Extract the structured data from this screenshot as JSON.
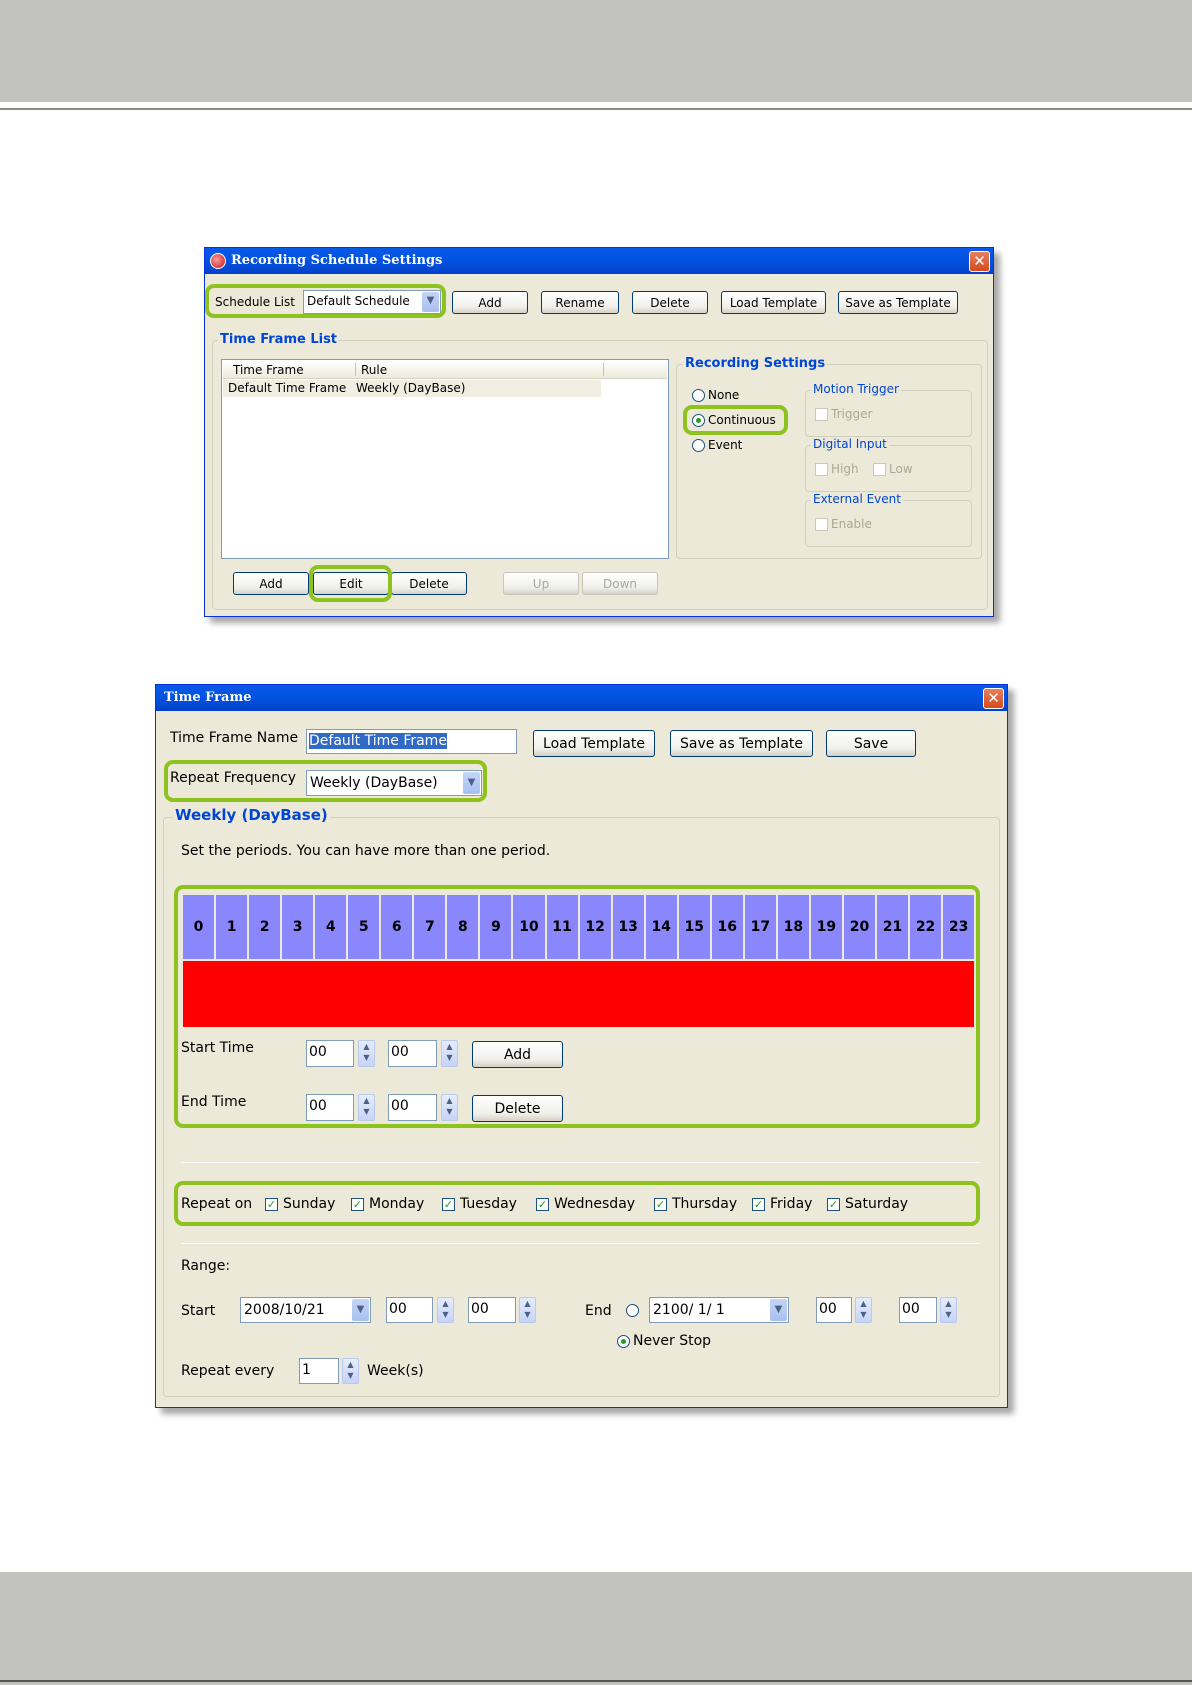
{
  "win1": {
    "title": "Recording Schedule Settings",
    "schedule_list_label": "Schedule List",
    "schedule_list_value": "Default Schedule",
    "buttons": {
      "add": "Add",
      "rename": "Rename",
      "delete": "Delete",
      "load_template": "Load Template",
      "save_as_template": "Save as Template"
    },
    "time_frame_list": {
      "title": "Time Frame List",
      "columns": [
        "Time Frame",
        "Rule"
      ],
      "rows": [
        {
          "time_frame": "Default Time Frame",
          "rule": "Weekly (DayBase)"
        }
      ],
      "buttons": {
        "add": "Add",
        "edit": "Edit",
        "delete": "Delete",
        "up": "Up",
        "down": "Down"
      }
    },
    "recording_settings": {
      "title": "Recording Settings",
      "modes": [
        "None",
        "Continuous",
        "Event"
      ],
      "selected_mode": "Continuous",
      "motion_trigger": {
        "title": "Motion Trigger",
        "trigger": "Trigger"
      },
      "digital_input": {
        "title": "Digital Input",
        "high": "High",
        "low": "Low"
      },
      "external_event": {
        "title": "External Event",
        "enable": "Enable"
      }
    }
  },
  "win2": {
    "title": "Time Frame",
    "name_label": "Time Frame Name",
    "name_value": "Default Time Frame",
    "buttons": {
      "load_template": "Load Template",
      "save_as_template": "Save as Template",
      "save": "Save"
    },
    "repeat_frequency_label": "Repeat Frequency",
    "repeat_frequency_value": "Weekly (DayBase)",
    "group_title": "Weekly (DayBase)",
    "instruction": "Set the periods. You can have more than one period.",
    "hours": [
      "0",
      "1",
      "2",
      "3",
      "4",
      "5",
      "6",
      "7",
      "8",
      "9",
      "10",
      "11",
      "12",
      "13",
      "14",
      "15",
      "16",
      "17",
      "18",
      "19",
      "20",
      "21",
      "22",
      "23"
    ],
    "start_time": {
      "label": "Start Time",
      "hour": "00",
      "minute": "00",
      "button": "Add"
    },
    "end_time": {
      "label": "End Time",
      "hour": "00",
      "minute": "00",
      "button": "Delete"
    },
    "repeat_on": {
      "label": "Repeat on",
      "days": [
        "Sunday",
        "Monday",
        "Tuesday",
        "Wednesday",
        "Thursday",
        "Friday",
        "Saturday"
      ]
    },
    "range": {
      "label": "Range:",
      "start_label": "Start",
      "start_date": "2008/10/21",
      "start_hour": "00",
      "start_minute": "00",
      "end_label": "End",
      "end_date": "2100/ 1/ 1",
      "end_hour": "00",
      "end_minute": "00",
      "never_stop": "Never Stop"
    },
    "repeat_every": {
      "label": "Repeat every",
      "value": "1",
      "unit": "Week(s)"
    }
  },
  "colors": {
    "highlight": "#8dc21f",
    "hour_cell": "#8a86fb",
    "period_band": "#ff0000",
    "group_title": "#0046d5"
  }
}
